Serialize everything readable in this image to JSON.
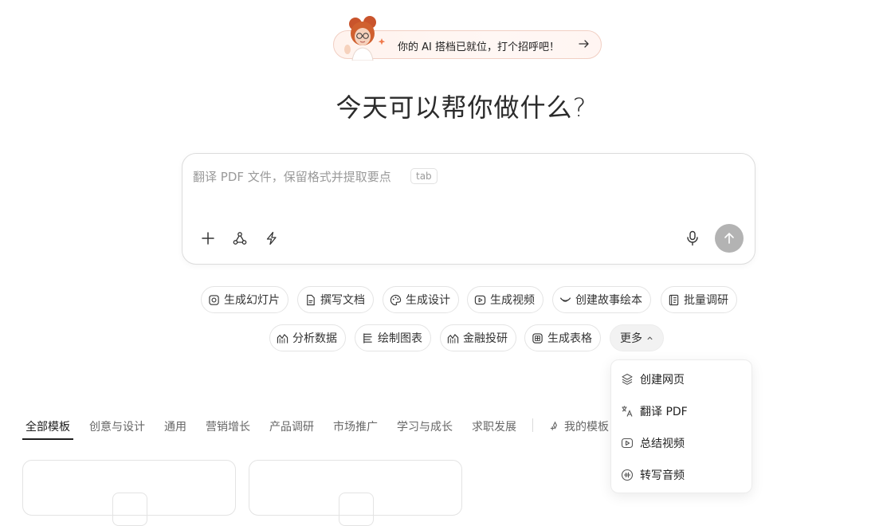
{
  "banner": {
    "text": "你的 AI 搭档已就位，打个招呼吧！",
    "accent": "#f1cfc3"
  },
  "title": "今天可以帮你做什么?",
  "composer": {
    "placeholder": "翻译 PDF 文件，保留格式并提取要点",
    "tab_hint": "tab",
    "tools": [
      "plus-icon",
      "nodes-icon",
      "lightning-icon"
    ],
    "mic": "microphone-icon",
    "send": "arrow-up-icon"
  },
  "chips_row1": [
    {
      "label": "生成幻灯片",
      "icon": "slides-icon"
    },
    {
      "label": "撰写文档",
      "icon": "document-icon"
    },
    {
      "label": "生成设计",
      "icon": "palette-icon"
    },
    {
      "label": "生成视频",
      "icon": "video-icon"
    },
    {
      "label": "创建故事绘本",
      "icon": "book-icon"
    },
    {
      "label": "批量调研",
      "icon": "research-icon"
    }
  ],
  "chips_row2": [
    {
      "label": "分析数据",
      "icon": "chart-icon"
    },
    {
      "label": "绘制图表",
      "icon": "chart-draw-icon"
    },
    {
      "label": "金融投研",
      "icon": "finance-icon"
    },
    {
      "label": "生成表格",
      "icon": "table-icon"
    }
  ],
  "more_label": "更多",
  "dropdown": [
    {
      "label": "创建网页",
      "icon": "layers-icon"
    },
    {
      "label": "翻译 PDF",
      "icon": "translate-icon"
    },
    {
      "label": "总结视频",
      "icon": "play-icon"
    },
    {
      "label": "转写音频",
      "icon": "audio-icon"
    }
  ],
  "categories": [
    "全部模板",
    "创意与设计",
    "通用",
    "营销增长",
    "产品调研",
    "市场推广",
    "学习与成长",
    "求职发展"
  ],
  "my_templates": "我的模板"
}
